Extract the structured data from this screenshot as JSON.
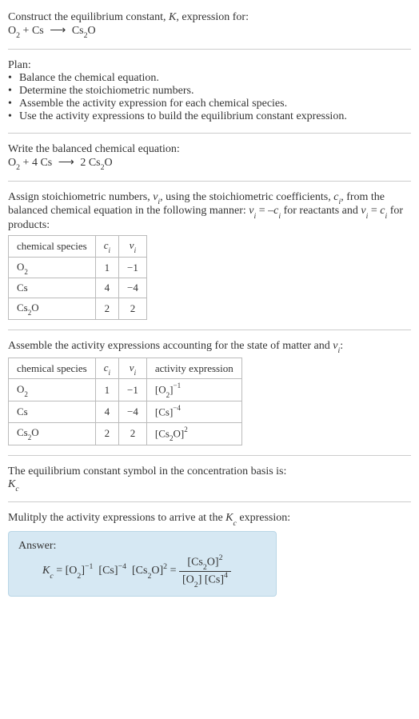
{
  "intro": {
    "line1a": "Construct the equilibrium constant, ",
    "K": "K",
    "line1b": ", expression for:"
  },
  "plan": {
    "heading": "Plan:",
    "b1": "Balance the chemical equation.",
    "b2": "Determine the stoichiometric numbers.",
    "b3": "Assemble the activity expression for each chemical species.",
    "b4": "Use the activity expressions to build the equilibrium constant expression."
  },
  "balanced_heading": "Write the balanced chemical equation:",
  "stoich_text": {
    "p1": "Assign stoichiometric numbers, ",
    "nu": "ν",
    "i": "i",
    "p2": ", using the stoichiometric coefficients, ",
    "c": "c",
    "p3": ", from the balanced chemical equation in the following manner: ",
    "eq1a": " = –",
    "p4": " for reactants and ",
    "eq2a": " = ",
    "p5": " for products:"
  },
  "table1": {
    "h_species": "chemical species",
    "h_c": "c",
    "h_nu": "ν",
    "r1_c": "1",
    "r1_nu": "−1",
    "r2_c": "4",
    "r2_nu": "−4",
    "r3_c": "2",
    "r3_nu": "2"
  },
  "assemble_text": {
    "p1": "Assemble the activity expressions accounting for the state of matter and ",
    "p2": ":"
  },
  "table2": {
    "h_species": "chemical species",
    "h_c": "c",
    "h_nu": "ν",
    "h_act": "activity expression",
    "r1_c": "1",
    "r1_nu": "−1",
    "r2_c": "4",
    "r2_nu": "−4",
    "r3_c": "2",
    "r3_nu": "2"
  },
  "kc_symbol_text": "The equilibrium constant symbol in the concentration basis is:",
  "kc_label": "K",
  "kc_sub": "c",
  "multiply_text": {
    "p1": "Mulitply the activity expressions to arrive at the ",
    "p2": " expression:"
  },
  "answer_label": "Answer:",
  "species": {
    "O2_base": "O",
    "O2_sub": "2",
    "Cs": "Cs",
    "Cs2O_a": "Cs",
    "Cs2O_sub": "2",
    "Cs2O_b": "O"
  },
  "coeffs": {
    "four": "4",
    "two": "2"
  },
  "exps": {
    "m1": "−1",
    "m4": "−4",
    "p2": "2",
    "p4": "4"
  },
  "ops": {
    "plus": " + ",
    "eq": " = "
  }
}
